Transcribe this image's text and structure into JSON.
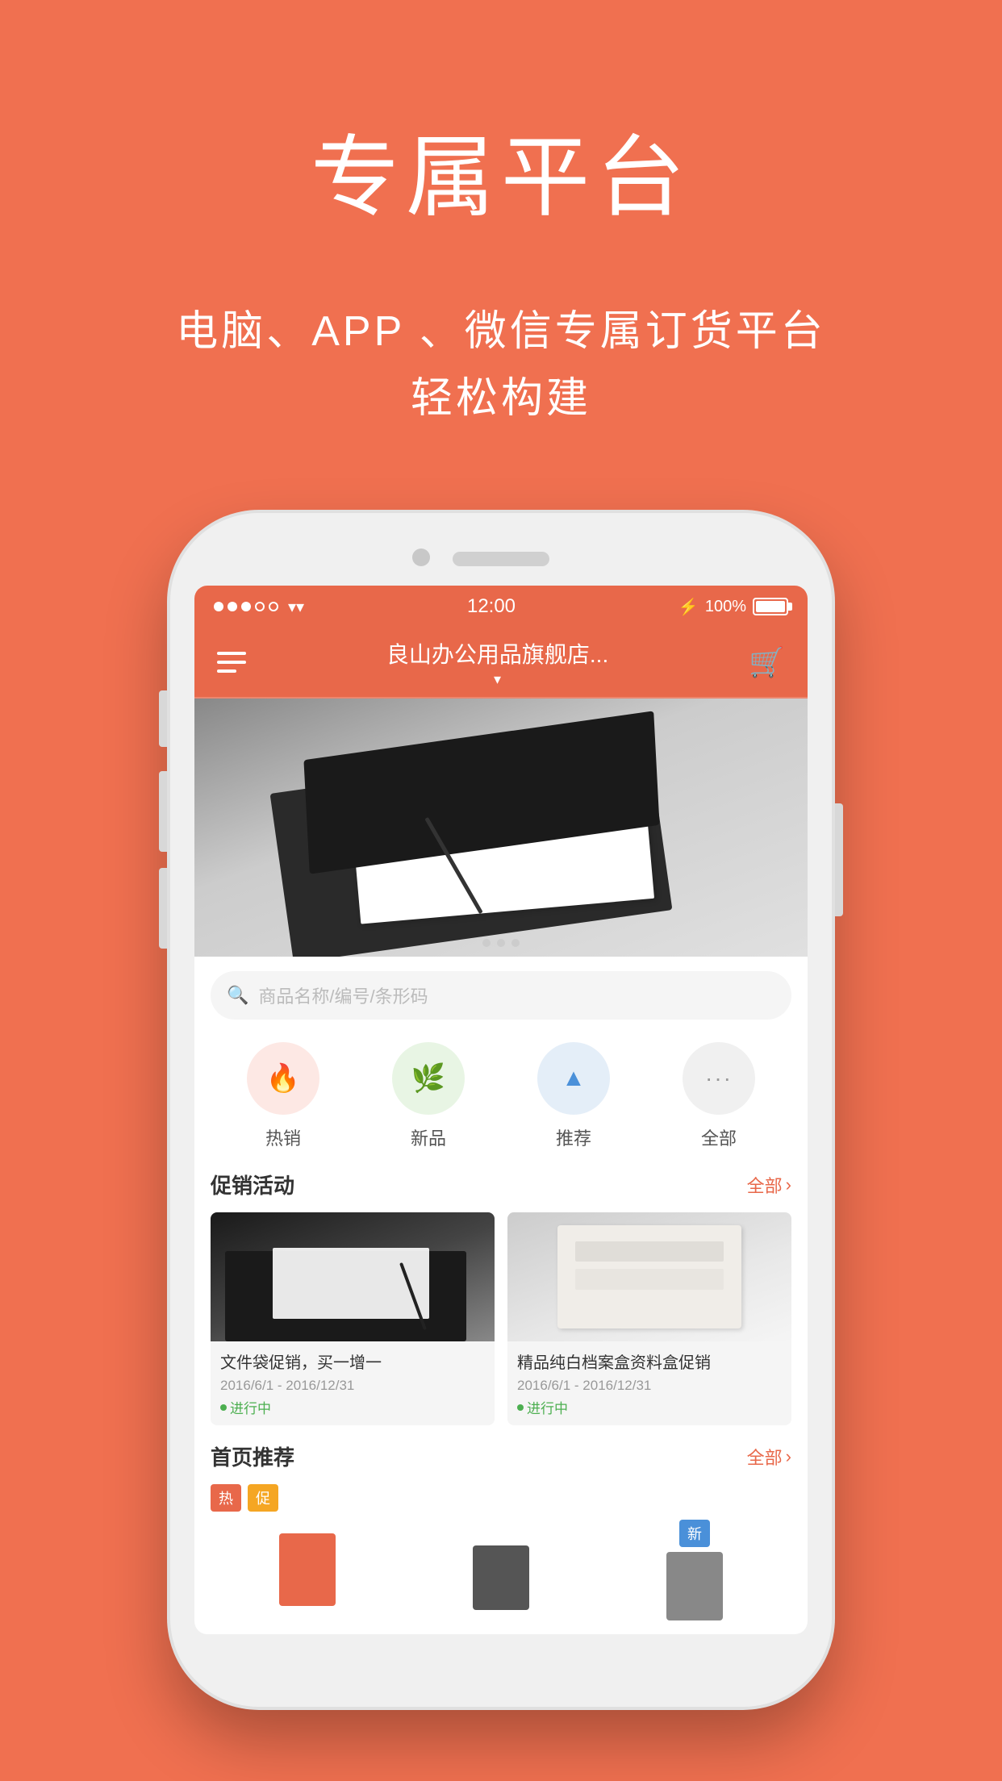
{
  "page": {
    "background_color": "#F07050",
    "header": {
      "title": "专属平台",
      "subtitle_line1": "电脑、APP 、微信专属订货平台",
      "subtitle_line2": "轻松构建"
    },
    "phone": {
      "status_bar": {
        "time": "12:00",
        "battery": "100%",
        "signal_dots": [
          "filled",
          "filled",
          "filled",
          "empty",
          "empty"
        ],
        "wifi": "WiFi"
      },
      "nav_bar": {
        "title": "良山办公用品旗舰店...",
        "arrow": "▾"
      },
      "search": {
        "placeholder": "商品名称/编号/条形码"
      },
      "categories": [
        {
          "label": "热销",
          "icon": "🔥",
          "style": "cat-hot"
        },
        {
          "label": "新品",
          "icon": "🌿",
          "style": "cat-new"
        },
        {
          "label": "推荐",
          "icon": "▲",
          "style": "cat-rec"
        },
        {
          "label": "全部",
          "icon": "···",
          "style": "cat-all"
        }
      ],
      "promotions": {
        "section_title": "促销活动",
        "more_label": "全部",
        "items": [
          {
            "name": "文件袋促销，买一增一",
            "date_range": "2016/6/1 - 2016/12/31",
            "status": "进行中",
            "status_color": "#4CAF50"
          },
          {
            "name": "精品纯白档案盒资料盒促销",
            "date_range": "2016/6/1 - 2016/12/31",
            "status": "·",
            "status_color": "#4CAF50"
          }
        ]
      },
      "recommendations": {
        "section_title": "首页推荐",
        "more_label": "全部",
        "tags": [
          {
            "label": "热",
            "style": "tag-hot"
          },
          {
            "label": "促",
            "style": "tag-promo"
          },
          {
            "label": "新",
            "style": "tag-new"
          }
        ]
      }
    }
  }
}
